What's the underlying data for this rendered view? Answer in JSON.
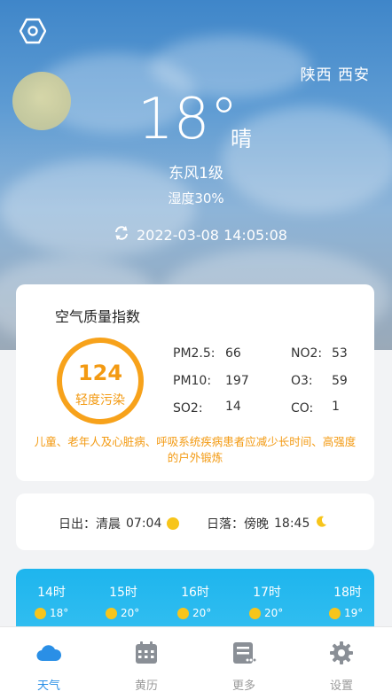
{
  "header": {
    "location": "陕西 西安",
    "temperature": "18°",
    "condition": "晴",
    "wind": "东风1级",
    "humidity": "湿度30%",
    "updated": "2022-03-08 14:05:08"
  },
  "aqi": {
    "title": "空气质量指数",
    "value": "124",
    "level": "轻度污染",
    "pollutants": [
      {
        "label": "PM2.5:",
        "value": "66"
      },
      {
        "label": "NO2:",
        "value": "53"
      },
      {
        "label": "PM10:",
        "value": "197"
      },
      {
        "label": "O3:",
        "value": "59"
      },
      {
        "label": "SO2:",
        "value": "14"
      },
      {
        "label": "CO:",
        "value": "1"
      }
    ],
    "advice": "儿童、老年人及心脏病、呼吸系统疾病患者应减少长时间、高强度的户外锻炼"
  },
  "sun": {
    "sunrise_label": "日出：清晨",
    "sunrise_time": "07:04",
    "sunset_label": "日落：傍晚",
    "sunset_time": "18:45"
  },
  "hourly": [
    {
      "hour": "14时",
      "temp": "18°"
    },
    {
      "hour": "15时",
      "temp": "20°"
    },
    {
      "hour": "16时",
      "temp": "20°"
    },
    {
      "hour": "17时",
      "temp": "20°"
    },
    {
      "hour": "18时",
      "temp": "19°"
    }
  ],
  "tabs": [
    {
      "label": "天气",
      "icon": "cloud-icon"
    },
    {
      "label": "黄历",
      "icon": "calendar-icon"
    },
    {
      "label": "更多",
      "icon": "more-icon"
    },
    {
      "label": "设置",
      "icon": "gear-icon"
    }
  ],
  "colors": {
    "accent": "#2a8fe6",
    "aqi": "#f39a12",
    "hourly_bg": "#1eb5ee",
    "sun": "#f7c51b"
  }
}
